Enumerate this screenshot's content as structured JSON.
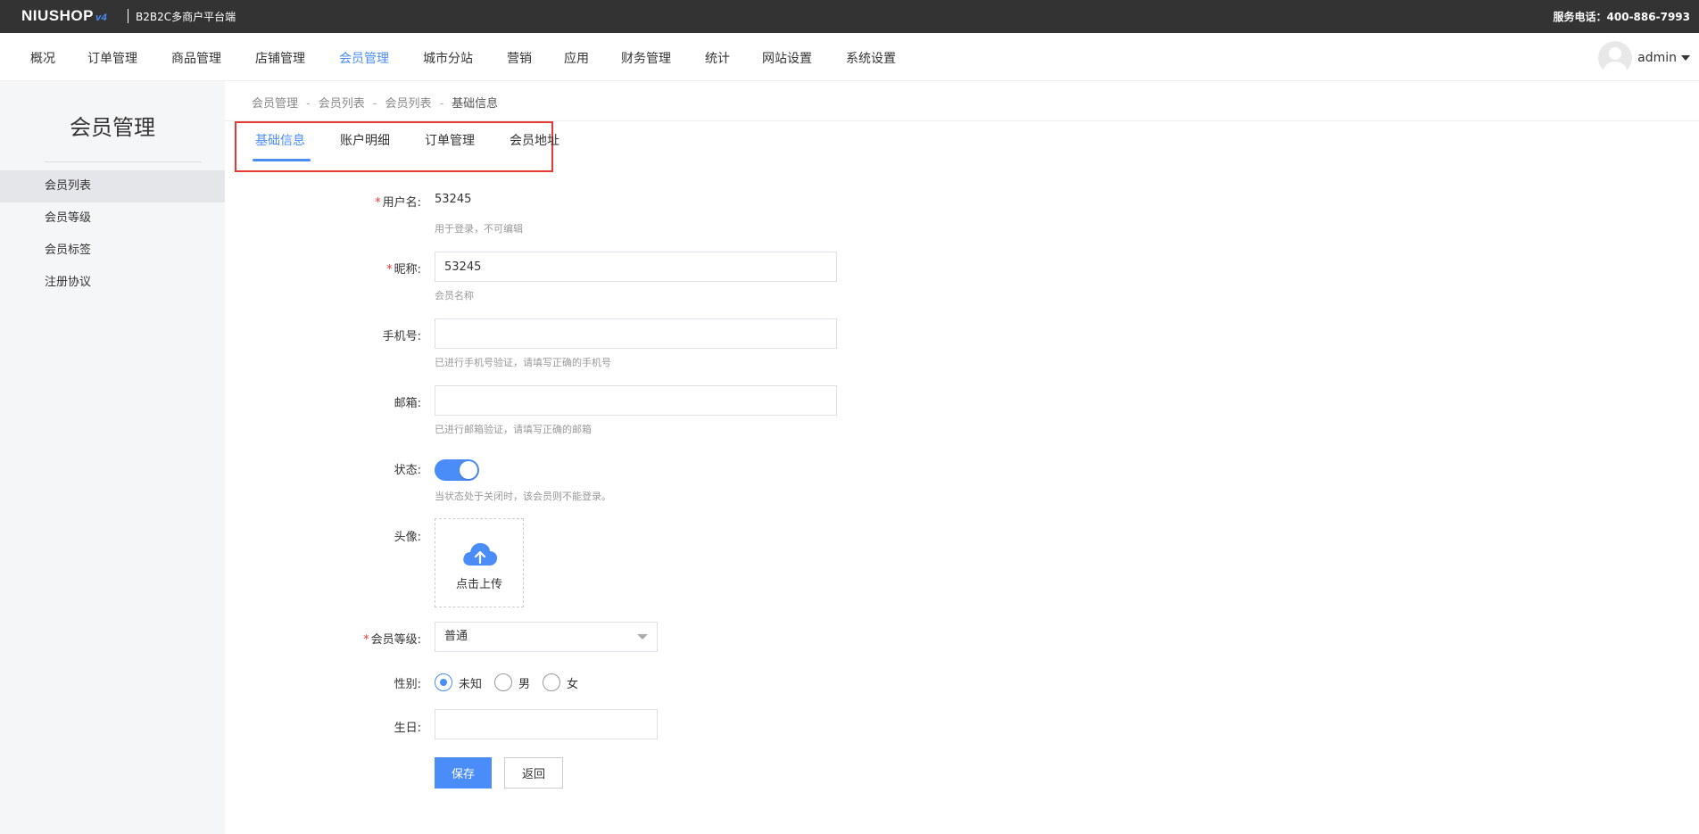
{
  "brand": {
    "logo": "NIUSHOP",
    "logo_version": "v4",
    "subtitle": "B2B2C多商户平台端"
  },
  "hotline": "服务电话：400-886-7993",
  "nav": {
    "items": [
      "概况",
      "订单管理",
      "商品管理",
      "店铺管理",
      "会员管理",
      "城市分站",
      "营销",
      "应用",
      "财务管理",
      "统计",
      "网站设置",
      "系统设置"
    ],
    "active": "会员管理"
  },
  "user": {
    "name": "admin"
  },
  "sidebar": {
    "title": "会员管理",
    "items": [
      "会员列表",
      "会员等级",
      "会员标签",
      "注册协议"
    ],
    "active": "会员列表"
  },
  "breadcrumb": [
    "会员管理",
    "会员列表",
    "会员列表",
    "基础信息"
  ],
  "breadcrumb_sep": "-",
  "tabs": {
    "items": [
      "基础信息",
      "账户明细",
      "订单管理",
      "会员地址"
    ],
    "active": "基础信息"
  },
  "form": {
    "required_mark": "*",
    "username": {
      "label": "用户名:",
      "value": "53245",
      "hint": "用于登录，不可编辑"
    },
    "nickname": {
      "label": "昵称:",
      "value": "53245",
      "hint": "会员名称"
    },
    "mobile": {
      "label": "手机号:",
      "value": "",
      "hint": "已进行手机号验证，请填写正确的手机号"
    },
    "email": {
      "label": "邮箱:",
      "value": "",
      "hint": "已进行邮箱验证，请填写正确的邮箱"
    },
    "status": {
      "label": "状态:",
      "enabled": true,
      "hint": "当状态处于关闭时，该会员则不能登录。"
    },
    "avatar": {
      "label": "头像:",
      "upload_text": "点击上传"
    },
    "level": {
      "label": "会员等级:",
      "value": "普通"
    },
    "gender": {
      "label": "性别:",
      "options": [
        "未知",
        "男",
        "女"
      ],
      "selected": "未知"
    },
    "birthday": {
      "label": "生日:",
      "value": ""
    },
    "save_label": "保存",
    "back_label": "返回"
  },
  "colors": {
    "accent": "#4a8df8",
    "topbar": "#333333",
    "highlight_box": "#e53935",
    "required": "#e53935"
  }
}
